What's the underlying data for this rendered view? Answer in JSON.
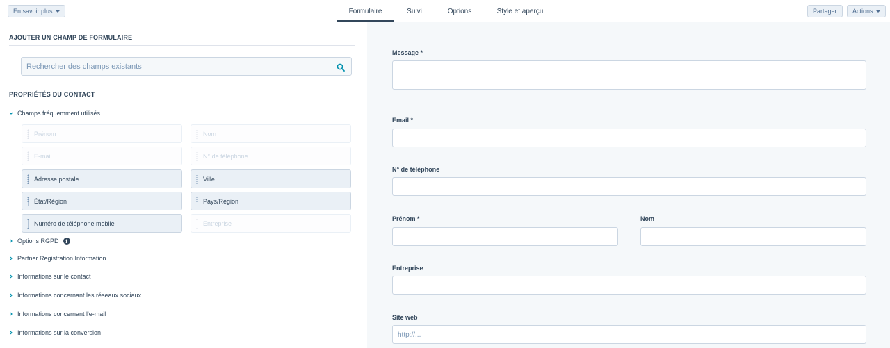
{
  "topbar": {
    "learn_more": "En savoir plus",
    "tabs": [
      {
        "label": "Formulaire"
      },
      {
        "label": "Suivi"
      },
      {
        "label": "Options"
      },
      {
        "label": "Style et aperçu"
      }
    ],
    "share": "Partager",
    "actions": "Actions"
  },
  "sidebar": {
    "add_field_title": "AJOUTER UN CHAMP DE FORMULAIRE",
    "search_placeholder": "Rechercher des champs existants",
    "contact_props_title": "PROPRIÉTÉS DU CONTACT",
    "frequent_group": "Champs fréquemment utilisés",
    "fields": [
      {
        "label": "Prénom",
        "enabled": false
      },
      {
        "label": "Nom",
        "enabled": false
      },
      {
        "label": "E-mail",
        "enabled": false
      },
      {
        "label": "N° de téléphone",
        "enabled": false
      },
      {
        "label": "Adresse postale",
        "enabled": true
      },
      {
        "label": "Ville",
        "enabled": true
      },
      {
        "label": "État/Région",
        "enabled": true
      },
      {
        "label": "Pays/Région",
        "enabled": true
      },
      {
        "label": "Numéro de téléphone mobile",
        "enabled": true
      },
      {
        "label": "Entreprise",
        "enabled": false
      }
    ],
    "groups": [
      {
        "label": "Options RGPD"
      },
      {
        "label": "Partner Registration Information"
      },
      {
        "label": "Informations sur le contact"
      },
      {
        "label": "Informations concernant les réseaux sociaux"
      },
      {
        "label": "Informations concernant l'e-mail"
      },
      {
        "label": "Informations sur la conversion"
      }
    ]
  },
  "form": {
    "message_label": "Message *",
    "email_label": "Email *",
    "phone_label": "N° de téléphone",
    "firstname_label": "Prénom *",
    "lastname_label": "Nom",
    "company_label": "Entreprise",
    "website_label": "Site web",
    "website_placeholder": "http://..."
  }
}
